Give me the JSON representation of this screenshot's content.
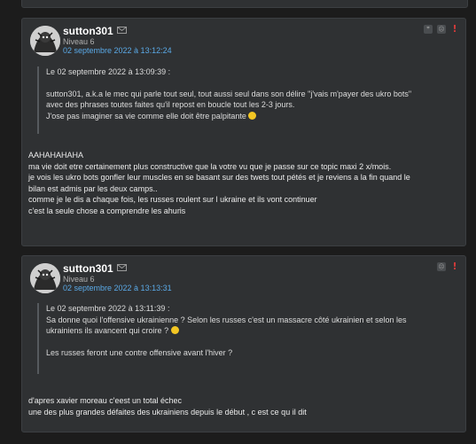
{
  "posts": [
    {
      "username": "sutton301",
      "level": "Niveau 6",
      "date": "02 septembre 2022 à 13:12:24",
      "quote": {
        "header": "Le 02 septembre 2022 à 13:09:39 :",
        "lines": [
          "sutton301, a.k.a le mec qui parle tout seul, tout aussi seul dans son délire \"j'vais m'payer des ukro bots\"",
          "avec des phrases toutes faites qu'il repost en boucle tout les 2-3 jours.",
          "J'ose pas imaginer sa vie comme elle doit être palpitante"
        ],
        "emoji": "smile-emoji"
      },
      "body": [
        "AAHAHAHAHA",
        "ma vie doit etre certainement plus constructive que la votre vu que je passe sur ce topic maxi 2 x/mois.",
        "je vois les ukro bots gonfler leur muscles en se basant sur des twets tout pétés et je reviens a la fin quand le",
        "bilan est admis par les deux camps..",
        "comme je le dis a chaque fois, les russes roulent sur l ukraine et ils vont continuer",
        "c'est la seule chose a comprendre les ahuris"
      ]
    },
    {
      "username": "sutton301",
      "level": "Niveau 6",
      "date": "02 septembre 2022 à 13:13:31",
      "quote": {
        "header": "Le 02 septembre 2022 à 13:11:39 :",
        "lines": [
          "Sa donne quoi l'offensive ukrainienne ? Selon les russes c'est un massacre côté ukrainien et selon les",
          "ukrainiens ils avancent qui croire ?"
        ],
        "emoji": "confused-emoji",
        "extra": "Les russes feront une contre offensive avant l'hiver ?"
      },
      "body": [
        "d'apres xavier moreau c'eest un total échec",
        "une des plus grandes défaites des ukrainiens depuis le début , c est ce qu il dit"
      ]
    }
  ],
  "icons": {
    "mail": "mail-icon",
    "quote": "quote-icon",
    "sad": "sad-face-icon",
    "alert": "alert-icon"
  },
  "colors": {
    "background": "#1c1c1c",
    "panel": "#2f3133",
    "date_link": "#5aa9e6",
    "alert": "#d23a3a"
  }
}
